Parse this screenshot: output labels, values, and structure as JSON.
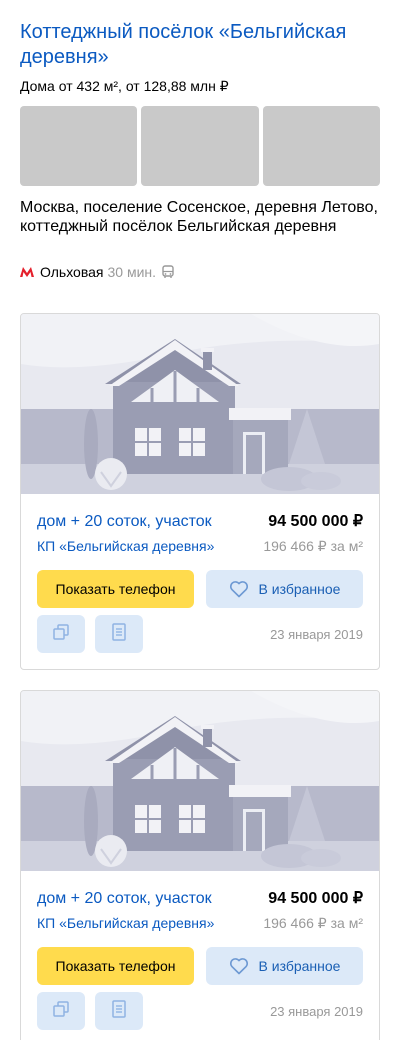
{
  "header": {
    "title": "Коттеджный посёлок «Бельгийская деревня»",
    "subtitle": "Дома от 432 м², от 128,88 млн ₽"
  },
  "address": "Москва, поселение Сосенское, деревня Летово, коттеджный посёлок Бельгийская деревня",
  "metro": {
    "icon": "metro-icon",
    "station": "Ольховая",
    "time": "30 мин.",
    "transport_icon": "bus-icon",
    "color": "#e4202c"
  },
  "offers": [
    {
      "type": "дом + 20 соток, участок",
      "price": "94 500 000 ₽",
      "village": "КП «Бельгийская деревня»",
      "price_per_m2": "196 466 ₽ за м²",
      "phone_button": "Показать телефон",
      "favorite_button": "В избранное",
      "date": "23 января 2019"
    },
    {
      "type": "дом + 20 соток, участок",
      "price": "94 500 000 ₽",
      "village": "КП «Бельгийская деревня»",
      "price_per_m2": "196 466 ₽ за м²",
      "phone_button": "Показать телефон",
      "favorite_button": "В избранное",
      "date": "23 января 2019"
    }
  ],
  "colors": {
    "link": "#0b5ac1",
    "accent_button": "#ffdb4d",
    "secondary_button": "#dce9f8"
  }
}
